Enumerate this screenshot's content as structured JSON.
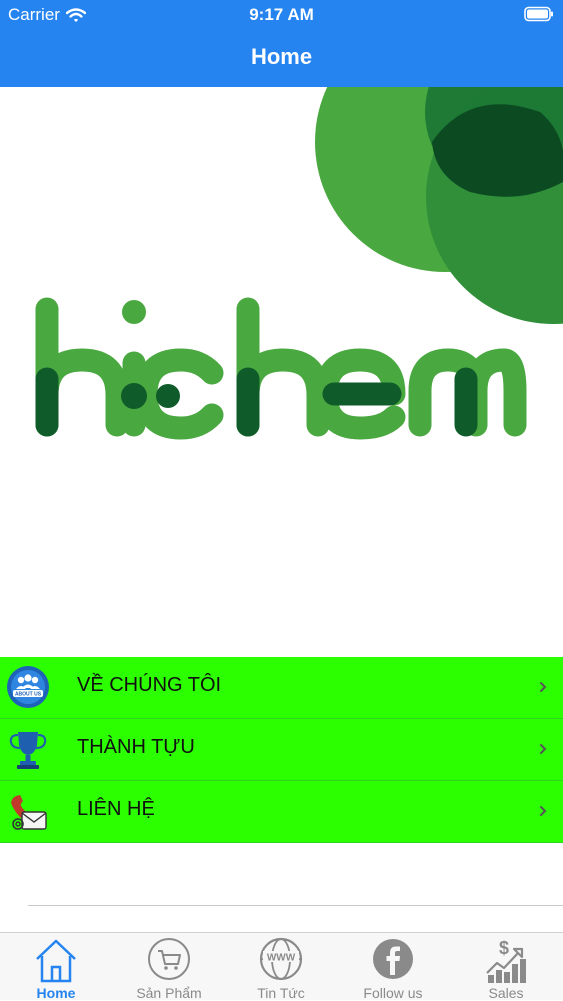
{
  "status_bar": {
    "carrier": "Carrier",
    "time": "9:17 AM"
  },
  "nav": {
    "title": "Home"
  },
  "hero": {
    "logo_text": "hichem",
    "brand_colors": {
      "light_green": "#4aa840",
      "mid_green": "#1e7a35",
      "dark_green": "#0c4a22"
    }
  },
  "menu": {
    "background": "#2bff00",
    "items": [
      {
        "label": "VỀ CHÚNG TÔI",
        "icon": "about-us-icon"
      },
      {
        "label": "THÀNH TỰU",
        "icon": "trophy-icon"
      },
      {
        "label": "LIÊN HỆ",
        "icon": "contact-phone-icon"
      }
    ]
  },
  "tabs": [
    {
      "label": "Home",
      "icon": "home-icon",
      "active": true
    },
    {
      "label": "Sản Phẩm",
      "icon": "cart-icon",
      "active": false
    },
    {
      "label": "Tin Tức",
      "icon": "globe-www-icon",
      "active": false
    },
    {
      "label": "Follow us",
      "icon": "facebook-icon",
      "active": false
    },
    {
      "label": "Sales",
      "icon": "sales-chart-icon",
      "active": false
    }
  ],
  "colors": {
    "accent": "#2584f0"
  }
}
